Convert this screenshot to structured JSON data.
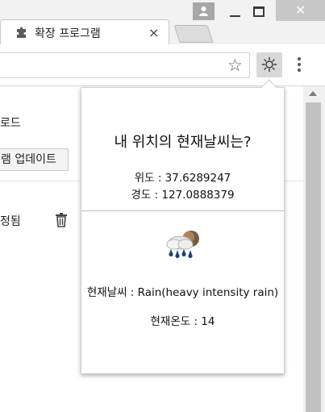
{
  "tab": {
    "title": "확장 프로그램",
    "close_glyph": "×",
    "icon": "puzzle-icon"
  },
  "window": {
    "close_glyph": "✕"
  },
  "toolbar": {
    "star_glyph": "☆",
    "extension_icon": "sun-icon"
  },
  "page": {
    "line1": "로드",
    "button_label": "램 업데이트",
    "line2": "정됨"
  },
  "popup": {
    "title": "내 위치의 현재날씨는?",
    "latitude": "위도 : 37.6289247",
    "longitude": "경도 : 127.0888379",
    "weather_icon": "heavy-rain-icon",
    "weather": "현재날씨 : Rain(heavy intensity rain)",
    "temperature": "현재온도 : 14"
  }
}
